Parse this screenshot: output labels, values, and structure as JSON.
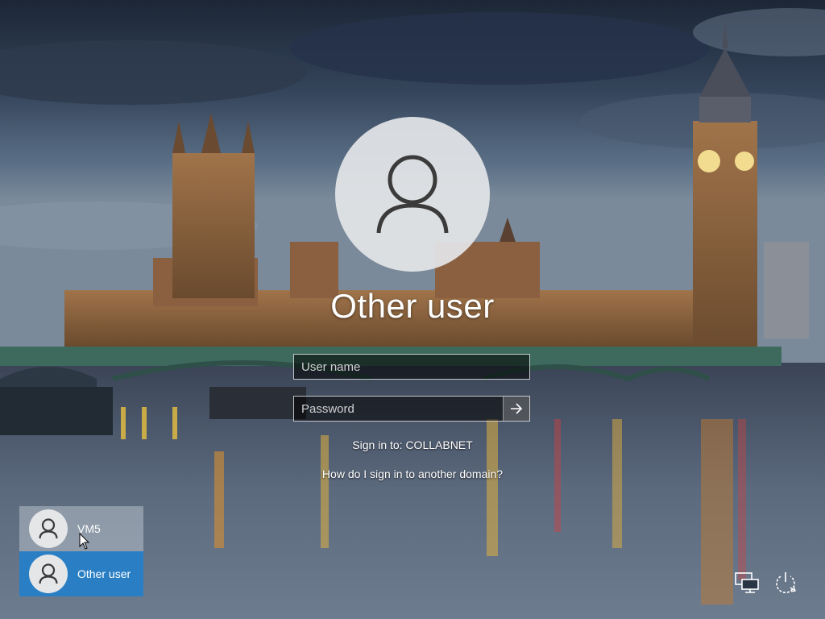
{
  "login": {
    "title": "Other user",
    "username_placeholder": "User name",
    "username_value": "",
    "password_placeholder": "Password",
    "password_value": "",
    "submit_icon": "arrow-right-icon",
    "signin_to": "Sign in to: COLLABNET",
    "domain_help_link": "How do I sign in to another domain?"
  },
  "users": [
    {
      "name": "VM5",
      "icon": "user-avatar-icon",
      "selected": false
    },
    {
      "name": "Other user",
      "icon": "user-avatar-icon",
      "selected": true
    }
  ],
  "corner_icons": {
    "network": "network-icon",
    "power": "power-icon"
  },
  "colors": {
    "selected_tile": "#2a7fc4",
    "hover_tile": "#c8d0d8",
    "avatar_bg": "#e4e6e8",
    "avatar_glyph": "#3b3b3b"
  }
}
